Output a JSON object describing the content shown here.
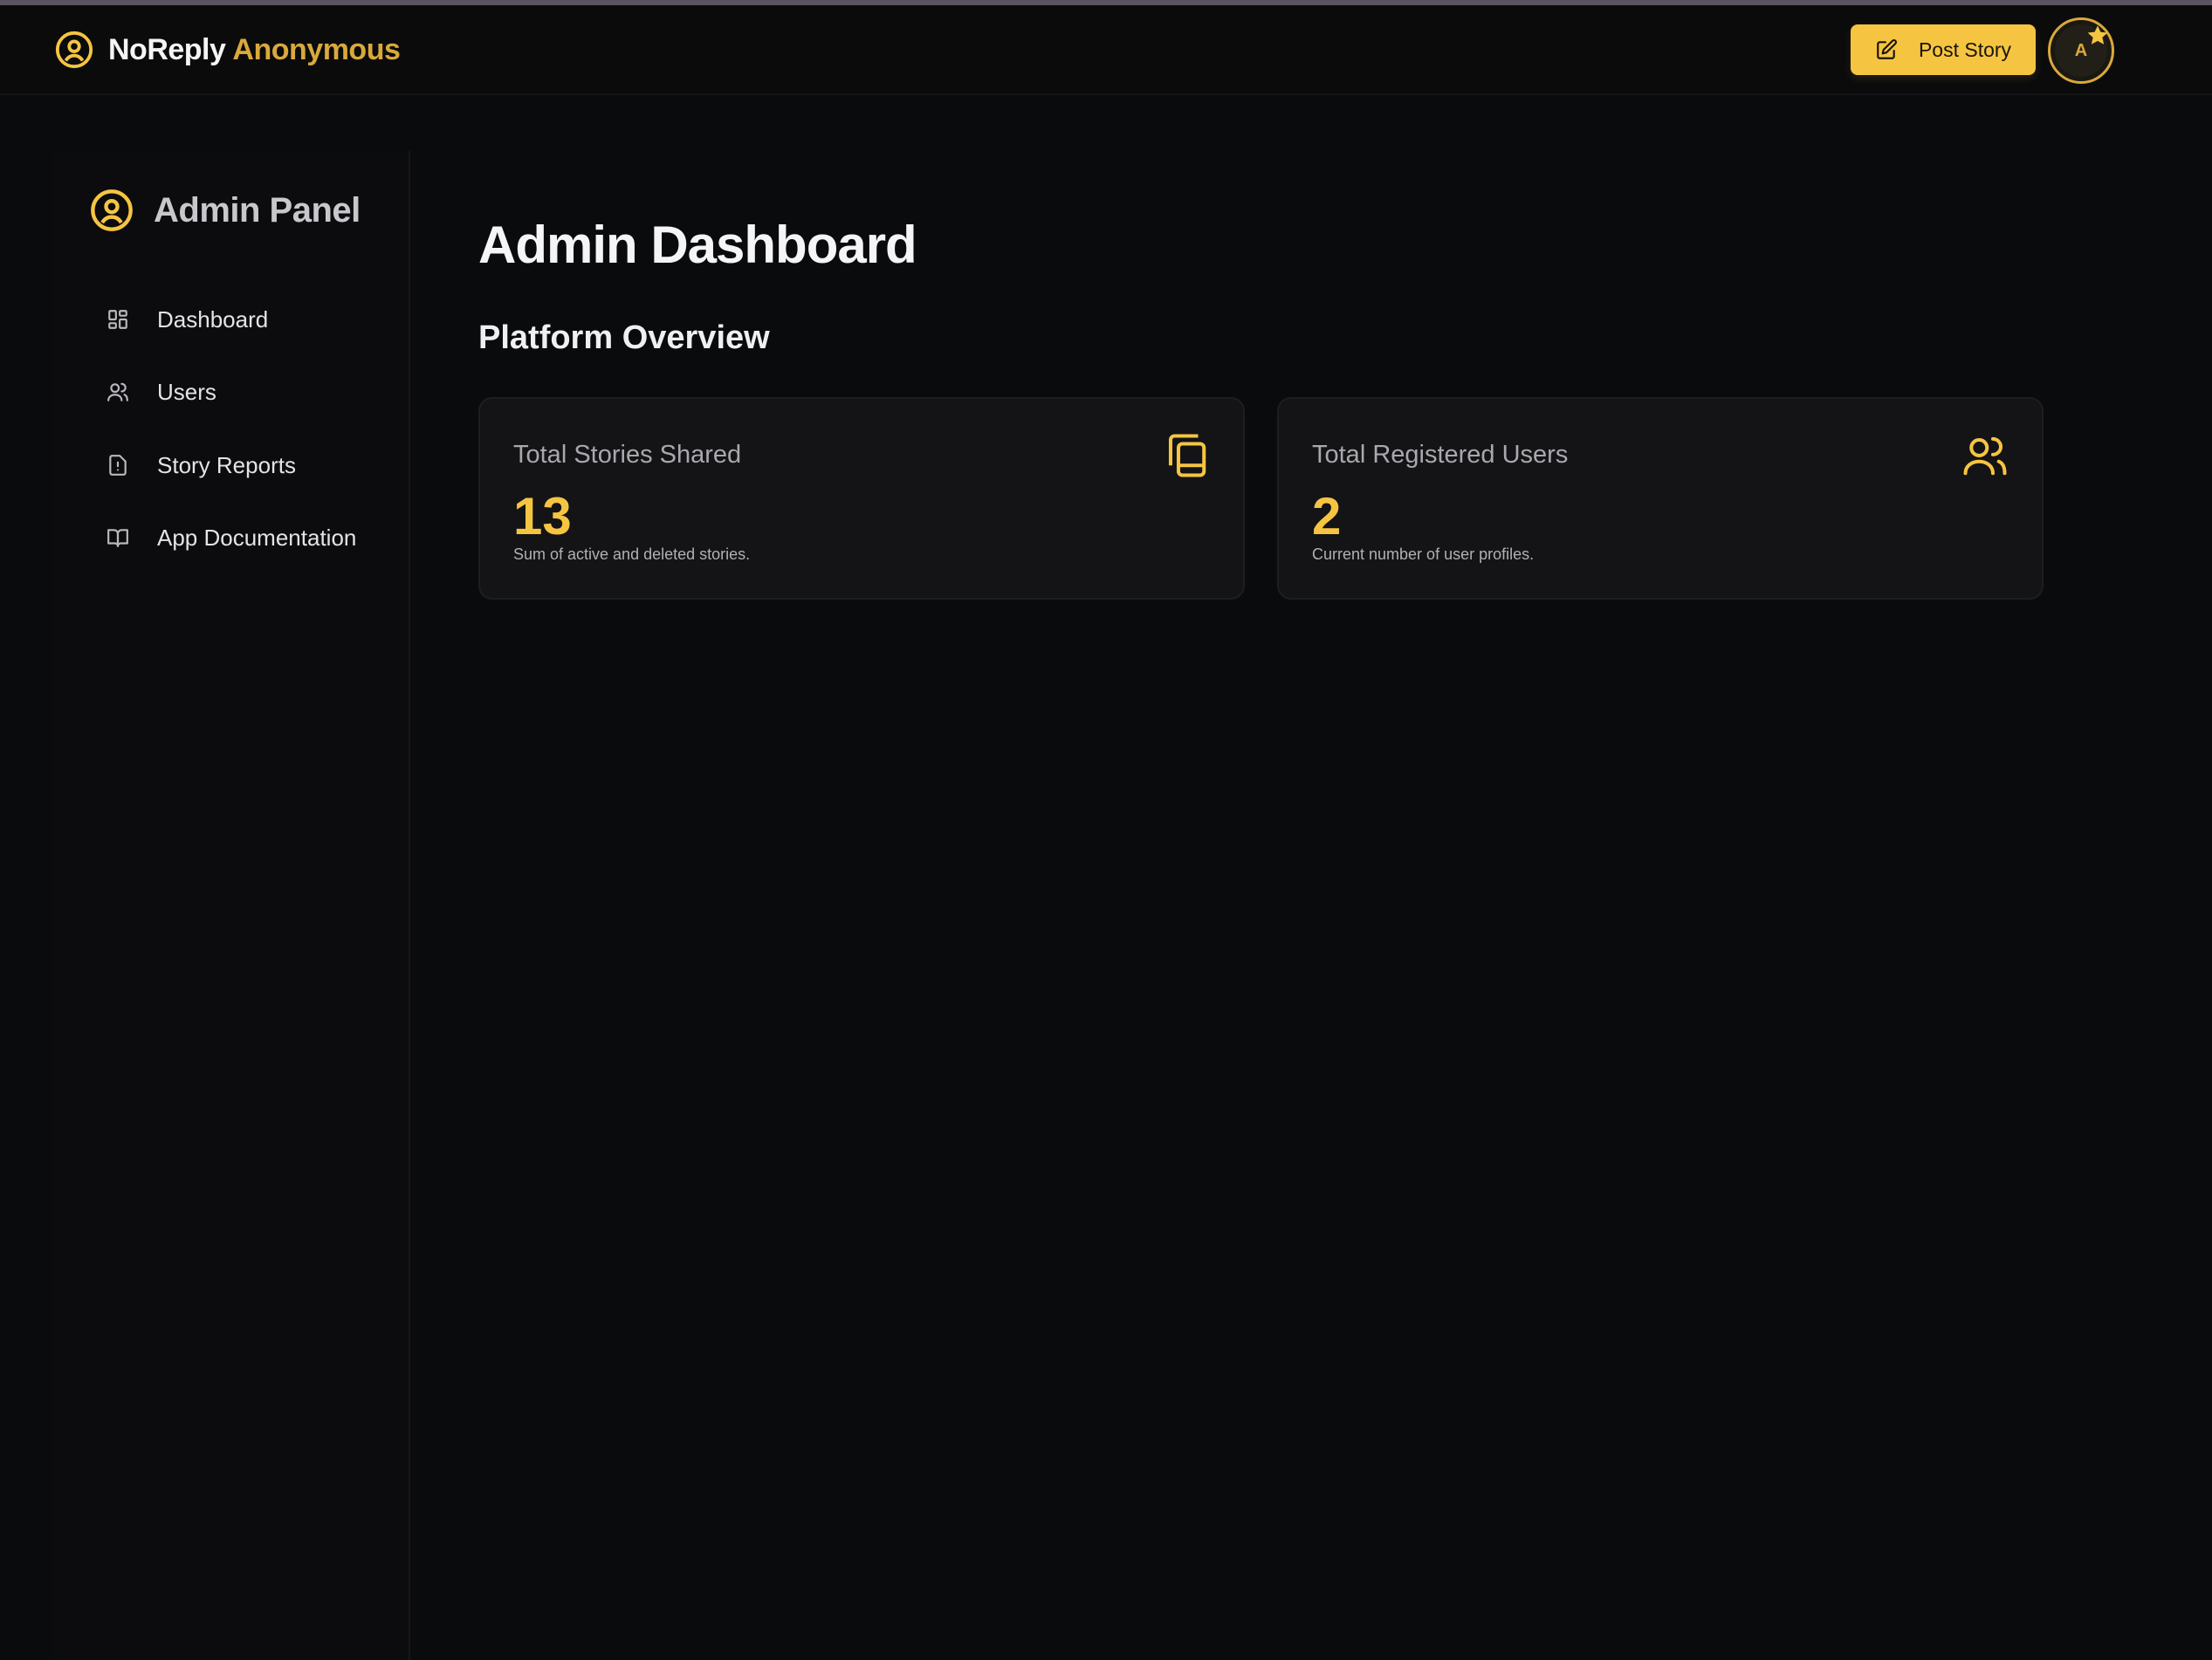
{
  "header": {
    "brand_primary": "NoReply",
    "brand_secondary": "Anonymous",
    "post_button_label": "Post Story",
    "avatar_initial": "A",
    "accent_color": "#f5c542"
  },
  "sidebar": {
    "title": "Admin Panel",
    "items": [
      {
        "label": "Dashboard",
        "icon": "grid-icon"
      },
      {
        "label": "Users",
        "icon": "users-icon"
      },
      {
        "label": "Story Reports",
        "icon": "report-icon"
      },
      {
        "label": "App Documentation",
        "icon": "book-icon"
      }
    ]
  },
  "main": {
    "title": "Admin Dashboard",
    "section_title": "Platform Overview",
    "cards": [
      {
        "label": "Total Stories Shared",
        "value": "13",
        "description": "Sum of active and deleted stories.",
        "icon": "stories-icon"
      },
      {
        "label": "Total Registered Users",
        "value": "2",
        "description": "Current number of user profiles.",
        "icon": "users-icon"
      }
    ]
  }
}
